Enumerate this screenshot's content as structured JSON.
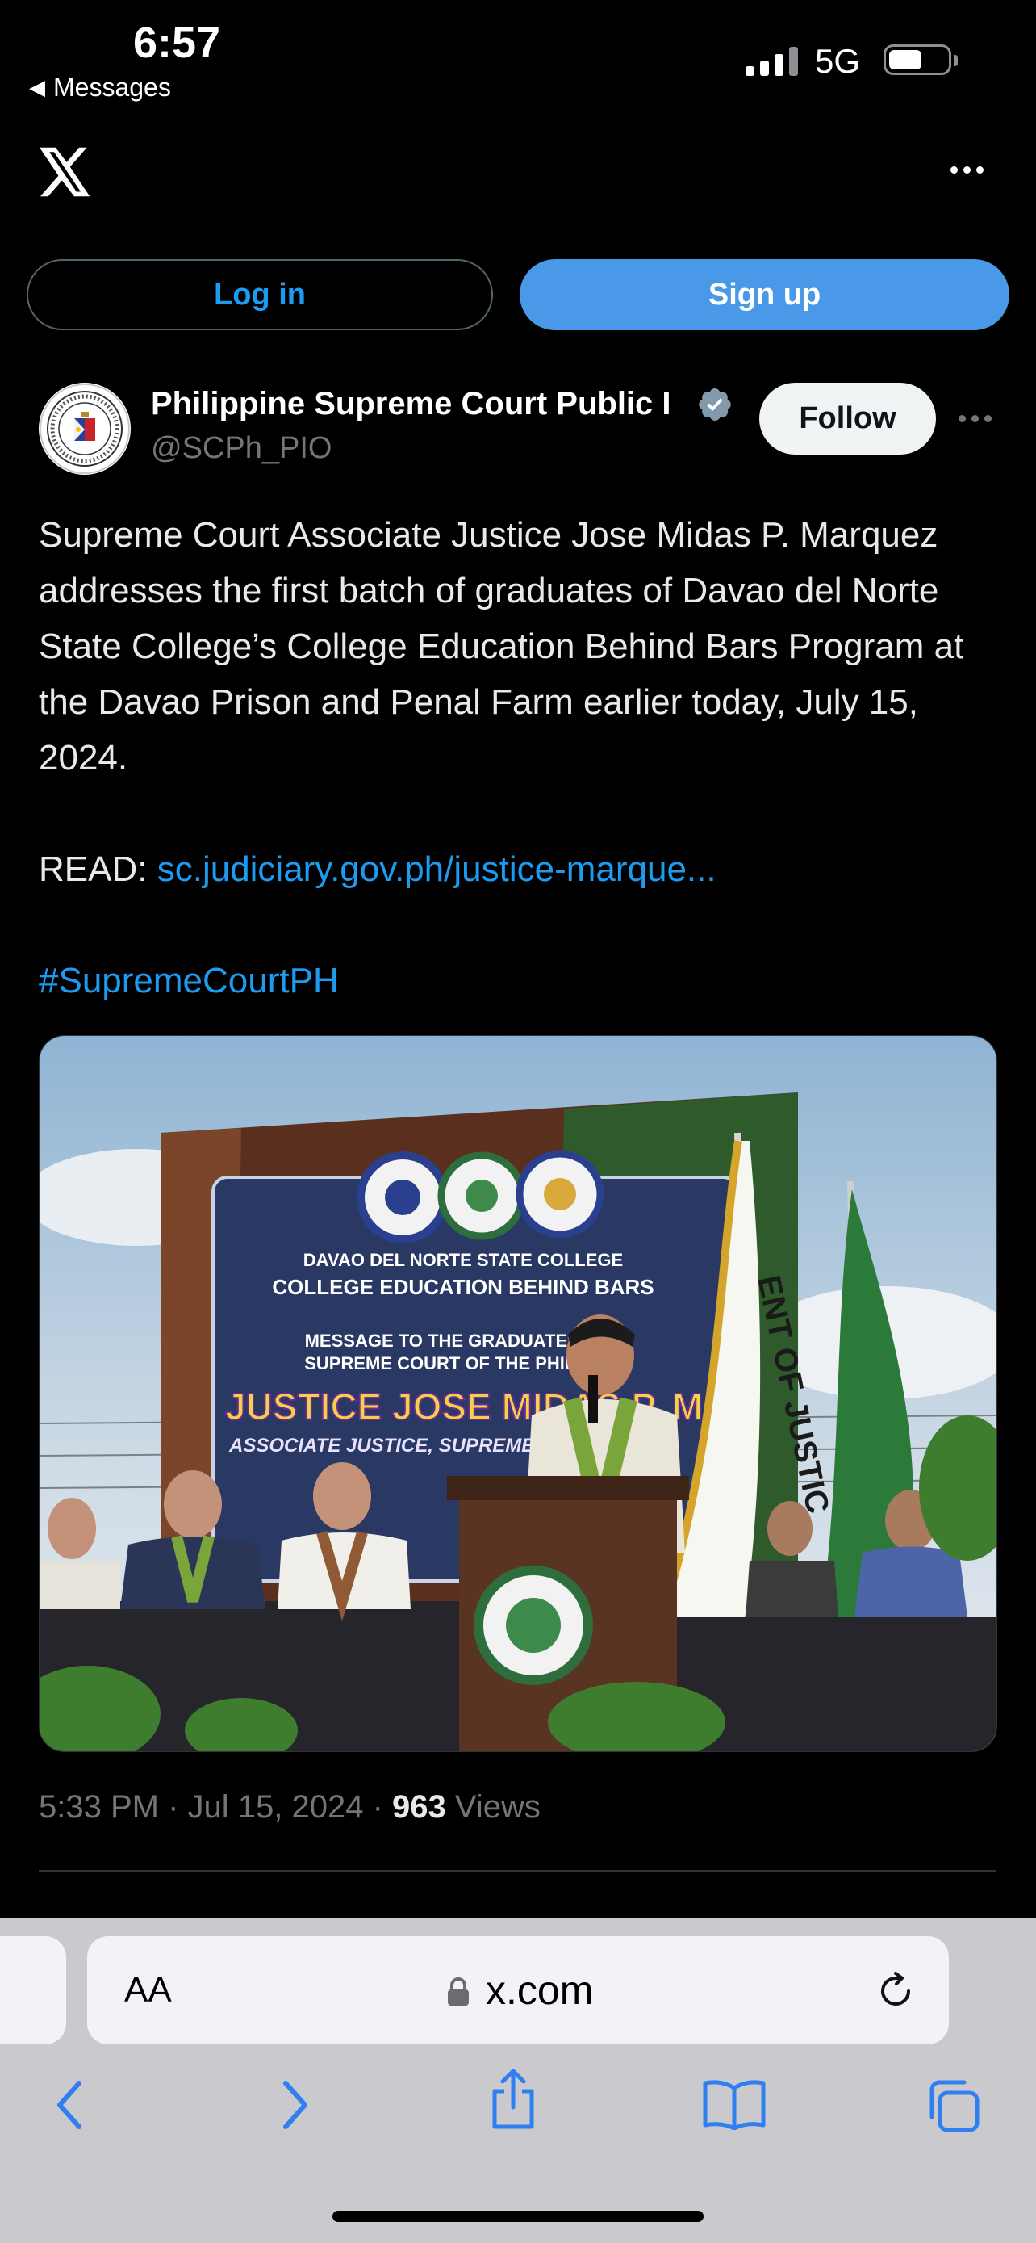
{
  "status_bar": {
    "time": "6:57",
    "back_label": "Messages",
    "network": "5G",
    "battery_level": 0.55
  },
  "header": {
    "logo": "x-logo-icon",
    "more": "more-icon"
  },
  "auth": {
    "login_label": "Log in",
    "signup_label": "Sign up"
  },
  "post": {
    "author_name": "Philippine Supreme Court Public I",
    "author_handle": "@SCPh_PIO",
    "follow_label": "Follow",
    "text": "Supreme Court Associate Justice Jose Midas P. Marquez addresses the first batch of graduates of Davao del Norte State College’s College Education Behind Bars Program at the Davao Prison and Penal Farm earlier today, July 15, 2024.",
    "read_prefix": "READ:",
    "read_link": "sc.judiciary.gov.ph/justice-marque...",
    "hashtag": "#SupremeCourtPH",
    "timestamp": "5:33 PM · Jul 15, 2024 · ",
    "views_count": "963",
    "views_label": " Views"
  },
  "photo": {
    "banner_line1": "DAVAO DEL NORTE STATE COLLEGE",
    "banner_line2": "COLLEGE EDUCATION BEHIND BARS",
    "banner_line3": "MESSAGE TO THE GRADUATES FRO",
    "banner_line4": "SUPREME COURT OF THE PHILIPPIN",
    "banner_name": "JUSTICE JOSE MIDAS P. M",
    "banner_title": "ASSOCIATE JUSTICE, SUPREME COURT O",
    "flag_text": "ENT OF JUSTIC",
    "podium_seal": "DAVAO DEL NORTE STATE COLLEGE"
  },
  "browser": {
    "aa_label": "AA",
    "url": "x.com"
  },
  "colors": {
    "accent": "#1d9bf0",
    "signup": "#4a99e9",
    "background": "#000000",
    "muted": "#71767b"
  }
}
